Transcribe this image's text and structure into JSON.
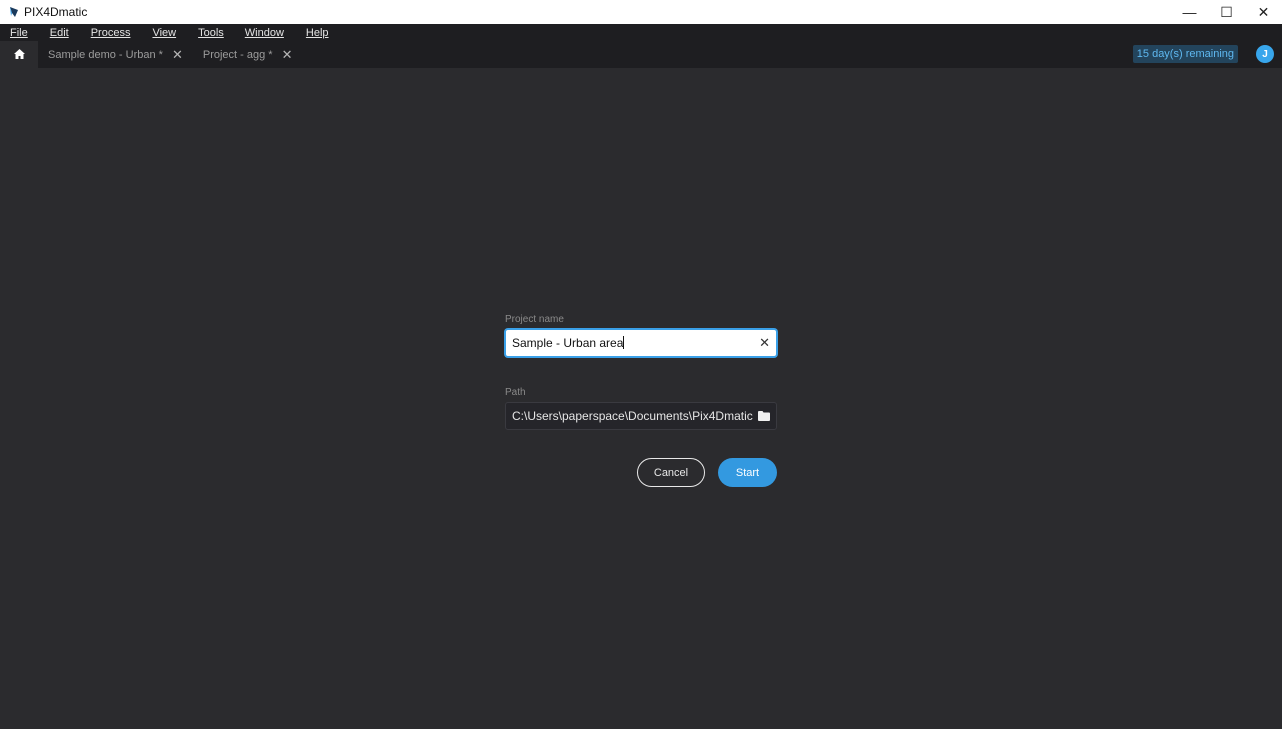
{
  "window": {
    "title": "PIX4Dmatic",
    "minimize_glyph": "—",
    "maximize_glyph": "☐",
    "close_glyph": "✕"
  },
  "menu": {
    "items": [
      {
        "label": "File"
      },
      {
        "label": "Edit"
      },
      {
        "label": "Process"
      },
      {
        "label": "View"
      },
      {
        "label": "Tools"
      },
      {
        "label": "Window"
      },
      {
        "label": "Help"
      }
    ]
  },
  "tabs": {
    "home_icon": "home-icon",
    "items": [
      {
        "label": "Sample demo - Urban *",
        "close": "✕"
      },
      {
        "label": "Project - agg *",
        "close": "✕"
      }
    ]
  },
  "header": {
    "trial": "15 day(s) remaining",
    "avatar_initial": "J"
  },
  "form": {
    "project_name_label": "Project name",
    "project_name_value": "Sample - Urban area",
    "clear_glyph": "✕",
    "path_label": "Path",
    "path_value": "C:\\Users\\paperspace\\Documents\\Pix4Dmatic",
    "cancel_label": "Cancel",
    "start_label": "Start"
  },
  "colors": {
    "accent": "#3399e0",
    "background": "#2b2b2e",
    "menubar": "#1e1e21"
  }
}
